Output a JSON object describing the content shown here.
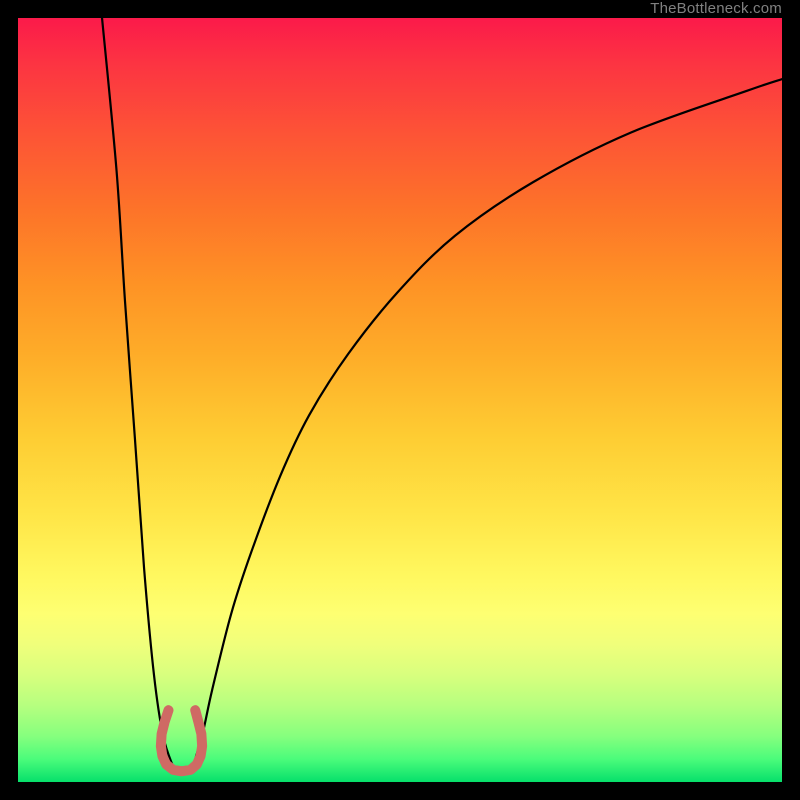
{
  "watermark": {
    "text": "TheBottleneck.com"
  },
  "colors": {
    "frame": "#000000",
    "curve": "#000000",
    "marker_fill": "#cf6a64",
    "marker_stroke": "#b75750",
    "gradient_stops": [
      "#fb1a4a",
      "#fc3442",
      "#fd5336",
      "#fd7329",
      "#fe9325",
      "#feaf29",
      "#fecd33",
      "#ffe547",
      "#fff85f",
      "#feff72",
      "#f0ff7b",
      "#d8ff7e",
      "#b6ff7f",
      "#86ff7e",
      "#4bfc7b",
      "#06e06b"
    ]
  },
  "chart_data": {
    "type": "line",
    "title": "",
    "xlabel": "",
    "ylabel": "",
    "xlim": [
      0,
      100
    ],
    "ylim": [
      0,
      100
    ],
    "grid": false,
    "legend": false,
    "series": [
      {
        "name": "left",
        "x": [
          11.0,
          12.9,
          14.0,
          15.3,
          16.5,
          17.8,
          19.0,
          20.3
        ],
        "y": [
          100.0,
          80.0,
          63.0,
          45.0,
          28.0,
          14.0,
          6.0,
          2.0
        ]
      },
      {
        "name": "right",
        "x": [
          22.9,
          24.2,
          25.4,
          27.9,
          30.5,
          34.3,
          38.1,
          43.2,
          49.6,
          57.2,
          67.4,
          80.2,
          95.5,
          100.0
        ],
        "y": [
          2.0,
          6.5,
          12.0,
          22.0,
          30.0,
          40.0,
          48.0,
          56.0,
          64.0,
          71.5,
          78.5,
          85.0,
          90.5,
          92.0
        ]
      }
    ],
    "marker_path": {
      "name": "valley-marker",
      "points_xy": [
        [
          19.7,
          9.4
        ],
        [
          19.2,
          7.9
        ],
        [
          18.8,
          6.3
        ],
        [
          18.7,
          4.7
        ],
        [
          18.9,
          3.4
        ],
        [
          19.4,
          2.3
        ],
        [
          20.3,
          1.6
        ],
        [
          21.4,
          1.4
        ],
        [
          22.6,
          1.6
        ],
        [
          23.4,
          2.3
        ],
        [
          23.9,
          3.4
        ],
        [
          24.1,
          4.7
        ],
        [
          24.0,
          6.3
        ],
        [
          23.6,
          7.9
        ],
        [
          23.2,
          9.4
        ]
      ]
    },
    "annotations": []
  }
}
